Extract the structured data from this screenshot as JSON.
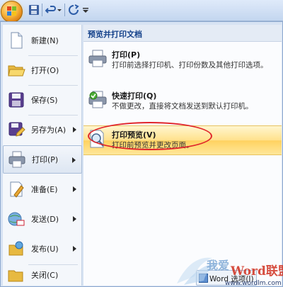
{
  "colors": {
    "accent": "#15428b",
    "highlight": "#ffd260",
    "annotation": "#e0252b"
  },
  "left_menu": {
    "items": [
      {
        "label": "新建(N)",
        "icon": "new-document-icon",
        "has_arrow": false
      },
      {
        "label": "打开(O)",
        "icon": "open-folder-icon",
        "has_arrow": false
      },
      {
        "label": "保存(S)",
        "icon": "save-icon",
        "has_arrow": false
      },
      {
        "label": "另存为(A)",
        "icon": "save-as-icon",
        "has_arrow": true
      },
      {
        "label": "打印(P)",
        "icon": "printer-icon",
        "has_arrow": true,
        "active": true
      },
      {
        "label": "准备(E)",
        "icon": "prepare-icon",
        "has_arrow": true
      },
      {
        "label": "发送(D)",
        "icon": "send-icon",
        "has_arrow": true
      },
      {
        "label": "发布(U)",
        "icon": "publish-icon",
        "has_arrow": true
      },
      {
        "label": "关闭(C)",
        "icon": "close-folder-icon",
        "has_arrow": false
      }
    ]
  },
  "right_pane": {
    "title": "预览并打印文档",
    "commands": [
      {
        "title": "打印(P)",
        "desc": "打印前选择打印机、打印份数及其他打印选项。",
        "icon": "printer-icon"
      },
      {
        "title": "快速打印(Q)",
        "desc": "不做更改，直接将文档发送到默认打印机。",
        "icon": "quick-print-icon"
      },
      {
        "title": "打印预览(V)",
        "desc": "打印前预览并更改页面。",
        "icon": "print-preview-icon",
        "highlighted": true
      }
    ]
  },
  "footer": {
    "word_options": "Word 选项(I)"
  },
  "watermark": {
    "text1": "我爱",
    "text2": "Word联盟",
    "url": "www.wordlm.com"
  }
}
